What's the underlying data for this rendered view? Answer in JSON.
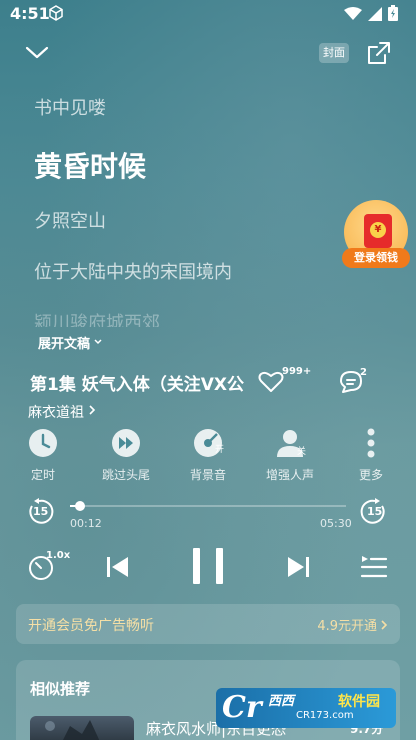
{
  "status_bar": {
    "time": "4:51",
    "icons": [
      "cube-icon",
      "wifi-icon",
      "signal-icon",
      "battery-icon"
    ]
  },
  "top_bar": {
    "cover_label": "封面",
    "icons": [
      "chevron-down-icon",
      "share-icon"
    ]
  },
  "lyrics": {
    "lines": [
      "书中见喽",
      "黄昏时候",
      "夕照空山",
      "位于大陆中央的宋国境内",
      "颍川骏府城西郊"
    ],
    "current_index": 1,
    "expand_label": "展开文稿"
  },
  "promo_badge": {
    "label": "登录领钱"
  },
  "episode": {
    "title": "第1集 妖气入体（关注VX公",
    "like_count": "999+",
    "comment_count": "2",
    "author": "麻衣道祖"
  },
  "functions": [
    {
      "label": "定时",
      "icon": "clock-icon"
    },
    {
      "label": "跳过头尾",
      "icon": "skip-intro-icon"
    },
    {
      "label": "背景音",
      "icon": "background-sound-icon",
      "badge": "开"
    },
    {
      "label": "增强人声",
      "icon": "voice-enhance-icon",
      "badge": "关"
    },
    {
      "label": "更多",
      "icon": "more-icon"
    }
  ],
  "playback": {
    "current_time": "00:12",
    "total_time": "05:30",
    "progress_fraction": 0.036,
    "skip_back_seconds": "15",
    "skip_forward_seconds": "15",
    "speed": "1.0x"
  },
  "vip_bar": {
    "text": "开通会员免广告畅听",
    "action": "4.9元开通"
  },
  "similar": {
    "title": "相似推荐",
    "items": [
      {
        "name": "麻衣风水师|东百更恐",
        "rating": "9.7分"
      }
    ]
  },
  "watermark": {
    "logo": "Cr",
    "name": "西西",
    "cn_name": "软件园",
    "url": "CR173.com"
  },
  "colors": {
    "accent_gold": "#f5dfa6",
    "promo_orange": "#f07a1b",
    "red_packet": "#e62b2b"
  }
}
